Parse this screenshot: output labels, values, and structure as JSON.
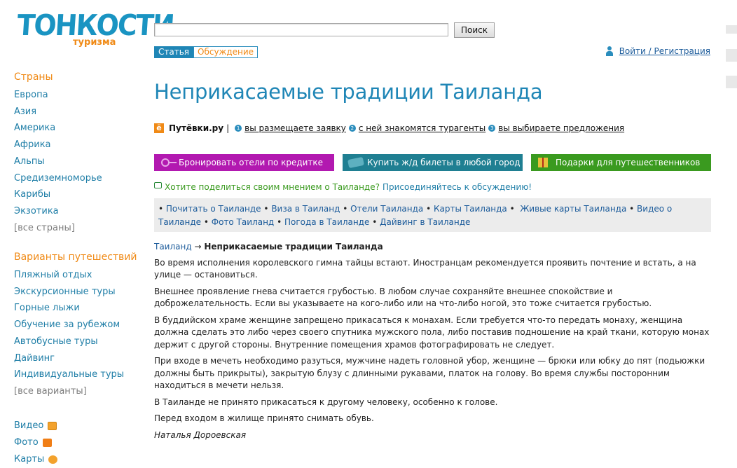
{
  "logo": {
    "main": "ТОНКОСТИ",
    "sub": "туризма"
  },
  "search": {
    "value": "",
    "placeholder": "",
    "button": "Поиск"
  },
  "tabs": {
    "article": "Статья",
    "discussion": "Обсуждение"
  },
  "login": {
    "label": "Войти / Регистрация"
  },
  "sidebar": {
    "countries_title": "Страны",
    "countries": [
      "Европа",
      "Азия",
      "Америка",
      "Африка",
      "Альпы",
      "Средиземноморье",
      "Карибы",
      "Экзотика"
    ],
    "countries_more": "[все страны]",
    "trips_title": "Варианты путешествий",
    "trips": [
      "Пляжный отдых",
      "Экскурсионные туры",
      "Горные лыжи",
      "Обучение за рубежом",
      "Автобусные туры",
      "Дайвинг",
      "Индивидуальные туры"
    ],
    "trips_more": "[все варианты]",
    "media": [
      "Видео",
      "Фото",
      "Карты"
    ]
  },
  "title": "Неприкасаемые традиции Таиланда",
  "putevki": {
    "brand": "Путёвки.ру",
    "sep": "|",
    "steps": [
      "вы размещаете заявку",
      "с ней знакомятся турагенты",
      "вы выбираете предложения"
    ],
    "nums": [
      "1",
      "2",
      "3"
    ]
  },
  "banners": [
    "Бронировать отели по кредитке",
    "Купить ж/д билеты в любой город",
    "Подарки для путешественников"
  ],
  "discuss": {
    "question": "Хотите поделиться своим мнением о Таиланде?",
    "join": "Присоединяйтесь к обсуждению!"
  },
  "links": [
    "Почитать о Таиланде",
    "Виза в Таиланд",
    "Отели Таиланда",
    "Карты Таиланда",
    "Живые карты Таиланда",
    "Видео о Таиланде",
    "Фото Таиланд",
    "Погода в Таиланде",
    "Дайвинг в Таиланде"
  ],
  "breadcrumb": {
    "parent": "Таиланд",
    "arrow": "→",
    "current": "Неприкасаемые традиции Таиланда"
  },
  "article": {
    "paragraphs": [
      "Во время исполнения королевского гимна тайцы встают. Иностранцам рекомендуется проявить почтение и встать, а на улице — остановиться.",
      "Внешнее проявление гнева считается грубостью. В любом случае сохраняйте внешнее спокойствие и доброжелательность. Если вы указываете на кого-либо или на что-либо ногой, это тоже считается грубостью.",
      "В буддийском храме женщине запрещено прикасаться к монахам. Если требуется что-то передать монаху, женщина должна сделать это либо через своего спутника мужского пола, либо поставив подношение на край ткани, которую монах держит с другой стороны. Внутренние помещения храмов фотографировать не следует.",
      "При входе в мечеть необходимо разуться, мужчине надеть головной убор, женщине — брюки или юбку до пят (подьюжки должны быть прикрыты), закрытую блузу с длинными рукавами, платок на голову. Во время службы посторонним находиться в мечети нельзя.",
      "В Таиланде не принято прикасаться к другому человеку, особенно к голове.",
      "Перед входом в жилище принято снимать обувь."
    ],
    "author": "Наталья Дороевская"
  },
  "colors": {
    "brand_blue": "#1f86b6",
    "accent_orange": "#f08a16",
    "banner_purple": "#b219b0",
    "banner_teal": "#1f7f92",
    "banner_green": "#3a9a1f"
  }
}
